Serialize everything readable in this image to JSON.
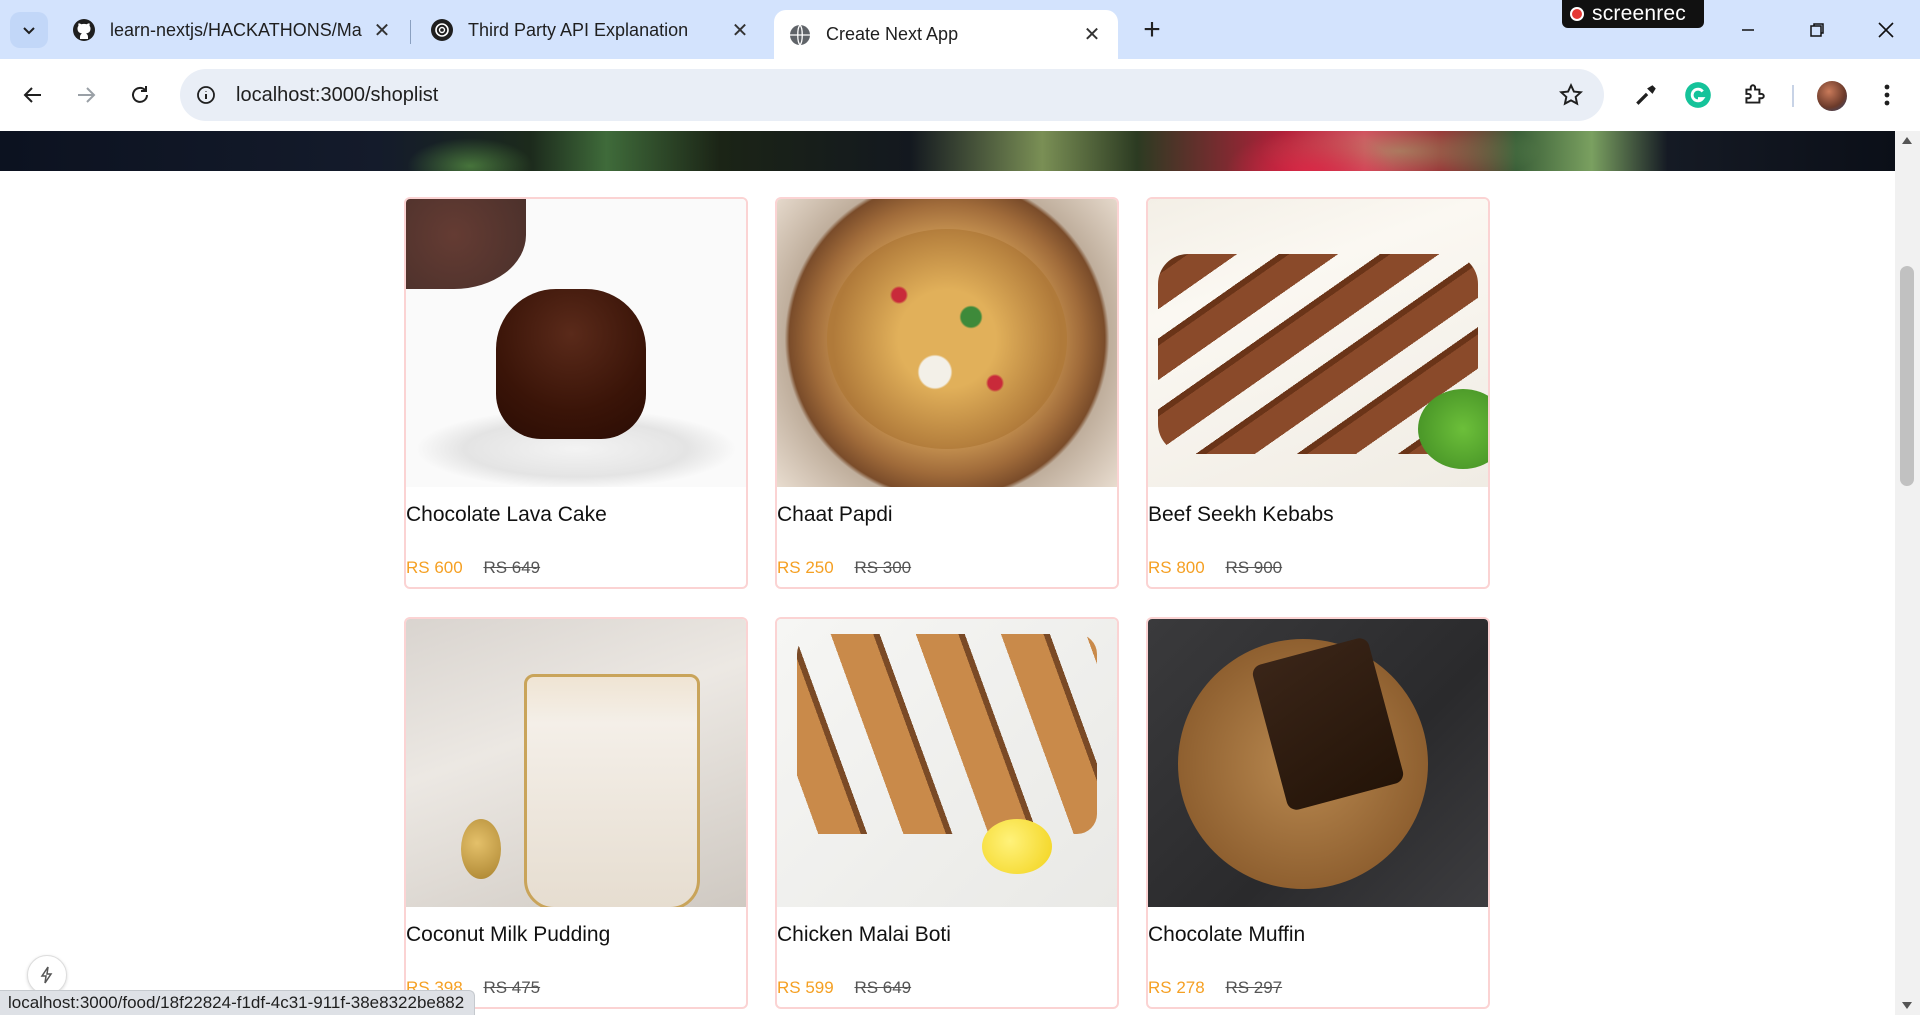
{
  "browser": {
    "tabs": [
      {
        "title": "learn-nextjs/HACKATHONS/Ma",
        "icon": "github-icon"
      },
      {
        "title": "Third Party API Explanation",
        "icon": "openai-icon"
      },
      {
        "title": "Create Next App",
        "icon": "globe-icon",
        "active": true
      }
    ],
    "recorder_label": "screenrec",
    "url": "localhost:3000/shoplist",
    "status_link": "localhost:3000/food/18f22824-f1df-4c31-911f-38e8322be882"
  },
  "page": {
    "currency_color": "#f5a023",
    "products": [
      {
        "name": "Chocolate Lava Cake",
        "price": "RS 600",
        "old_price": "RS 649",
        "image": "lava"
      },
      {
        "name": "Chaat Papdi",
        "price": "RS 250",
        "old_price": "RS 300",
        "image": "papdi"
      },
      {
        "name": "Beef Seekh Kebabs",
        "price": "RS 800",
        "old_price": "RS 900",
        "image": "kebab"
      },
      {
        "name": "Coconut Milk Pudding",
        "price": "RS 398",
        "old_price": "RS 475",
        "image": "pudding"
      },
      {
        "name": "Chicken Malai Boti",
        "price": "RS 599",
        "old_price": "RS 649",
        "image": "boti"
      },
      {
        "name": "Chocolate Muffin",
        "price": "RS 278",
        "old_price": "RS 297",
        "image": "muffin"
      }
    ]
  }
}
